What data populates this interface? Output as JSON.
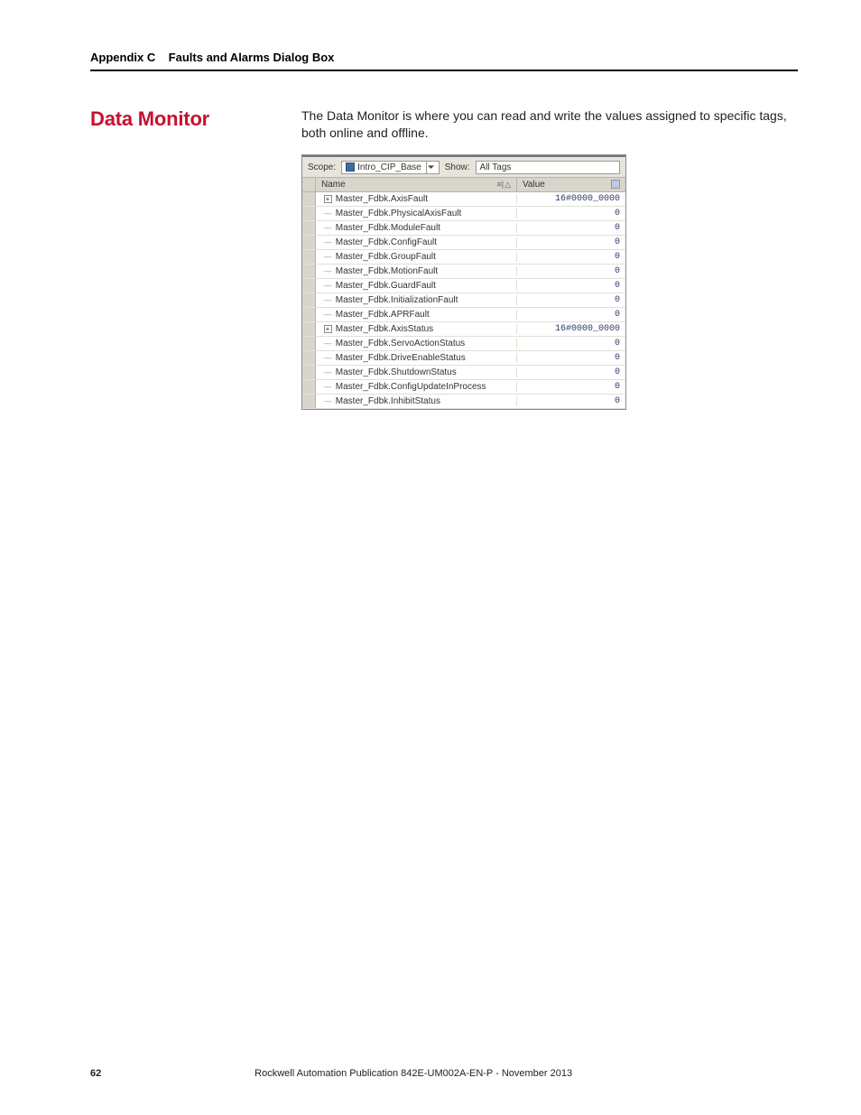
{
  "appendix_header": "Appendix C    Faults and Alarms Dialog Box",
  "section_title": "Data Monitor",
  "intro": "The Data Monitor is where you can read and write the values assigned to specific tags, both online and offline.",
  "monitor": {
    "scope_label": "Scope:",
    "scope_value": "Intro_CIP_Base",
    "show_label": "Show:",
    "show_value": "All Tags",
    "name_header": "Name",
    "value_header": "Value",
    "rows": [
      {
        "expand": "+",
        "name": "Master_Fdbk.AxisFault",
        "value": "16#0000_0000"
      },
      {
        "expand": "",
        "name": "Master_Fdbk.PhysicalAxisFault",
        "value": "0"
      },
      {
        "expand": "",
        "name": "Master_Fdbk.ModuleFault",
        "value": "0"
      },
      {
        "expand": "",
        "name": "Master_Fdbk.ConfigFault",
        "value": "0"
      },
      {
        "expand": "",
        "name": "Master_Fdbk.GroupFault",
        "value": "0"
      },
      {
        "expand": "",
        "name": "Master_Fdbk.MotionFault",
        "value": "0"
      },
      {
        "expand": "",
        "name": "Master_Fdbk.GuardFault",
        "value": "0"
      },
      {
        "expand": "",
        "name": "Master_Fdbk.InitializationFault",
        "value": "0"
      },
      {
        "expand": "",
        "name": "Master_Fdbk.APRFault",
        "value": "0"
      },
      {
        "expand": "+",
        "name": "Master_Fdbk.AxisStatus",
        "value": "16#0000_0000"
      },
      {
        "expand": "",
        "name": "Master_Fdbk.ServoActionStatus",
        "value": "0"
      },
      {
        "expand": "",
        "name": "Master_Fdbk.DriveEnableStatus",
        "value": "0"
      },
      {
        "expand": "",
        "name": "Master_Fdbk.ShutdownStatus",
        "value": "0"
      },
      {
        "expand": "",
        "name": "Master_Fdbk.ConfigUpdateInProcess",
        "value": "0"
      },
      {
        "expand": "",
        "name": "Master_Fdbk.InhibitStatus",
        "value": "0"
      }
    ]
  },
  "footer": {
    "page": "62",
    "publication": "Rockwell Automation Publication 842E-UM002A-EN-P - November 2013"
  }
}
